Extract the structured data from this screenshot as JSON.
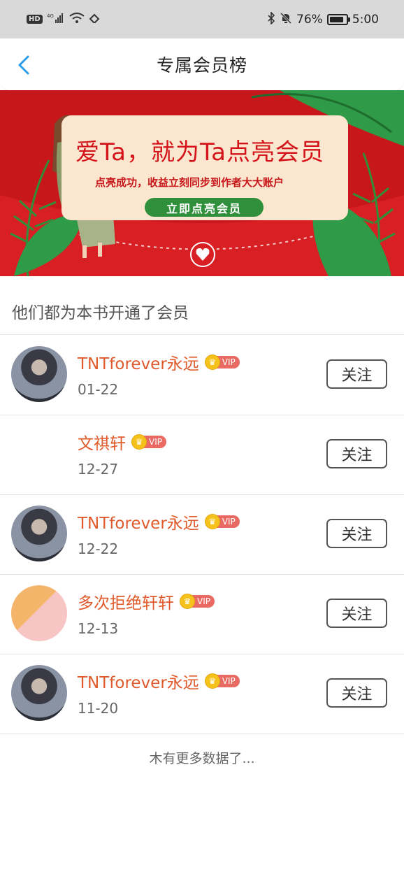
{
  "status_bar": {
    "badge_hd": "HD",
    "network": "4G",
    "battery_pct": "76%",
    "time": "5:00"
  },
  "nav": {
    "title": "专属会员榜"
  },
  "banner": {
    "headline": "爱Ta，就为Ta点亮会员",
    "subtitle": "点亮成功，收益立刻同步到作者大大账户",
    "cta": "立即点亮会员"
  },
  "section": {
    "title": "他们都为本书开通了会员"
  },
  "members": [
    {
      "name": "TNTforever永远",
      "vip": "VIP",
      "date": "01-22",
      "follow": "关注",
      "avatar": "dark"
    },
    {
      "name": "文祺轩",
      "vip": "VIP",
      "date": "12-27",
      "follow": "关注",
      "avatar": "empty"
    },
    {
      "name": "TNTforever永远",
      "vip": "VIP",
      "date": "12-22",
      "follow": "关注",
      "avatar": "dark"
    },
    {
      "name": "多次拒绝轩轩",
      "vip": "VIP",
      "date": "12-13",
      "follow": "关注",
      "avatar": "bright"
    },
    {
      "name": "TNTforever永远",
      "vip": "VIP",
      "date": "11-20",
      "follow": "关注",
      "avatar": "dark"
    }
  ],
  "footer": {
    "text": "木有更多数据了..."
  },
  "colors": {
    "accent_name": "#e05a2b",
    "banner_red": "#c8171b",
    "banner_green": "#2f8f3a",
    "back_arrow": "#2a9be8"
  }
}
